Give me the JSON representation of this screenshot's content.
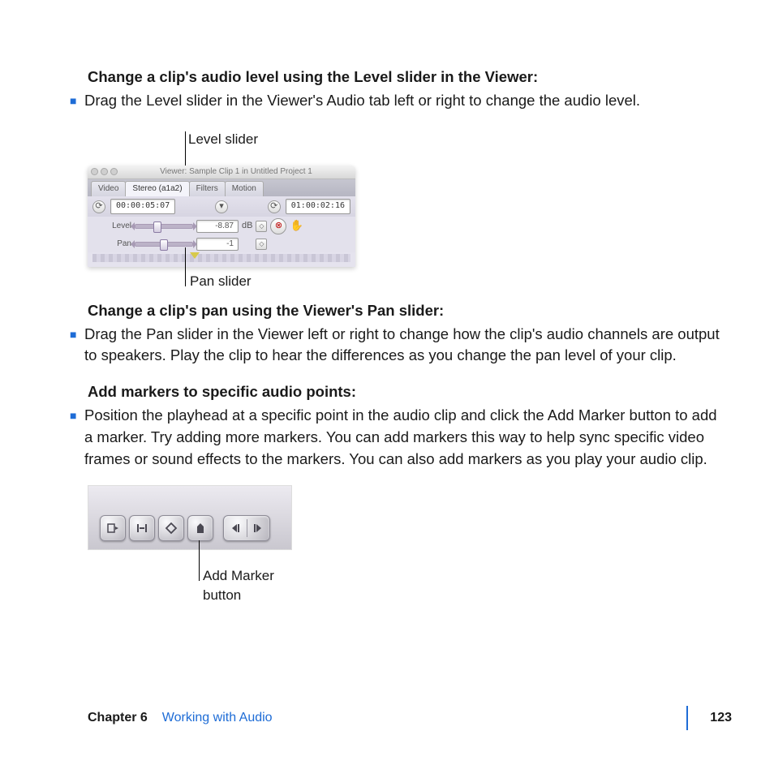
{
  "section1": {
    "heading": "Change a clip's audio level using the Level slider in the Viewer:",
    "bullet": "Drag the Level slider in the Viewer's Audio tab left or right to change the audio level."
  },
  "fig1": {
    "label_level": "Level slider",
    "label_pan": "Pan slider",
    "window_title": "Viewer: Sample Clip 1 in Untitled Project 1",
    "tabs": {
      "video": "Video",
      "stereo": "Stereo (a1a2)",
      "filters": "Filters",
      "motion": "Motion"
    },
    "tc_in": "00:00:05:07",
    "tc_out": "01:00:02:16",
    "level_label": "Level",
    "level_value": "-8.87",
    "level_unit": "dB",
    "pan_label": "Pan",
    "pan_value": "-1"
  },
  "section2": {
    "heading": "Change a clip's pan using the Viewer's Pan slider:",
    "bullet": "Drag the Pan slider in the Viewer left or right to change how the clip's audio channels are output to speakers. Play the clip to hear the differences as you change the pan level of your clip."
  },
  "section3": {
    "heading": "Add markers to specific audio points:",
    "bullet": "Position the playhead at a specific point in the audio clip and click the Add Marker button to add a marker. Try adding more markers. You can add markers this way to help sync specific video frames or sound effects to the markers. You can also add markers as you play your audio clip."
  },
  "fig2": {
    "label_add": "Add Marker button"
  },
  "footer": {
    "chapter": "Chapter 6",
    "title": "Working with Audio",
    "page": "123"
  }
}
